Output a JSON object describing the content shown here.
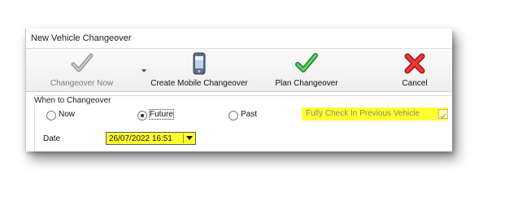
{
  "window": {
    "title": "New Vehicle Changeover"
  },
  "toolbar": {
    "changeover_now": {
      "label": "Changeover Now",
      "icon": "checkmark-gray-icon",
      "enabled": false
    },
    "create_mobile": {
      "label": "Create Mobile Changeover",
      "icon": "mobile-phone-icon"
    },
    "plan_changeover": {
      "label": "Plan Changeover",
      "icon": "checkmark-green-icon"
    },
    "cancel": {
      "label": "Cancel",
      "icon": "cancel-x-icon"
    }
  },
  "when_section": {
    "title": "When to Changeover",
    "options": [
      {
        "label": "Now",
        "selected": false
      },
      {
        "label": "Future",
        "selected": true
      },
      {
        "label": "Past",
        "selected": false
      }
    ],
    "full_check": {
      "label": "Fully Check In Previous Vehicle",
      "checked": true,
      "enabled": false
    }
  },
  "date": {
    "label": "Date",
    "value": "26/07/2022 16:51"
  },
  "colors": {
    "highlight": "#ffff31",
    "accent_green": "#3c9a48",
    "cancel_red": "#d42222"
  }
}
